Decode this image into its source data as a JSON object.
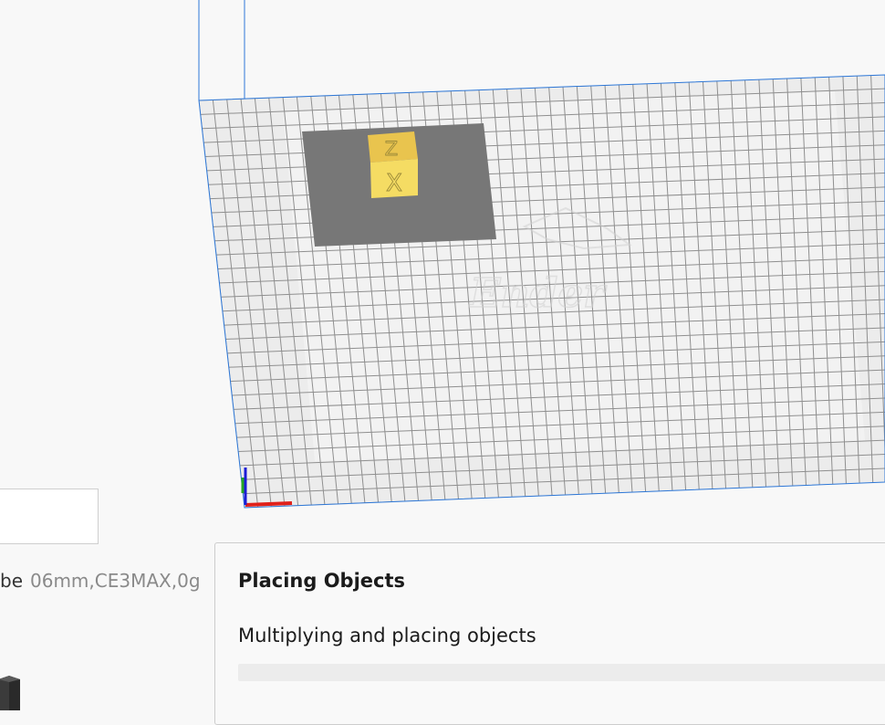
{
  "viewport": {
    "bed_logo_text": "Ender",
    "axis_colors": {
      "x": "#e0201a",
      "y": "#25a525",
      "z": "#1b1bd6"
    },
    "model_face_labels": [
      "Z",
      "X"
    ],
    "model_color": "#f3d55f"
  },
  "job": {
    "prefix": "be",
    "name": "06mm,CE3MAX,0g"
  },
  "dialog": {
    "title": "Placing Objects",
    "message": "Multiplying and placing objects",
    "progress": 0
  },
  "icons": {
    "bottom_left": "cube-icon"
  }
}
